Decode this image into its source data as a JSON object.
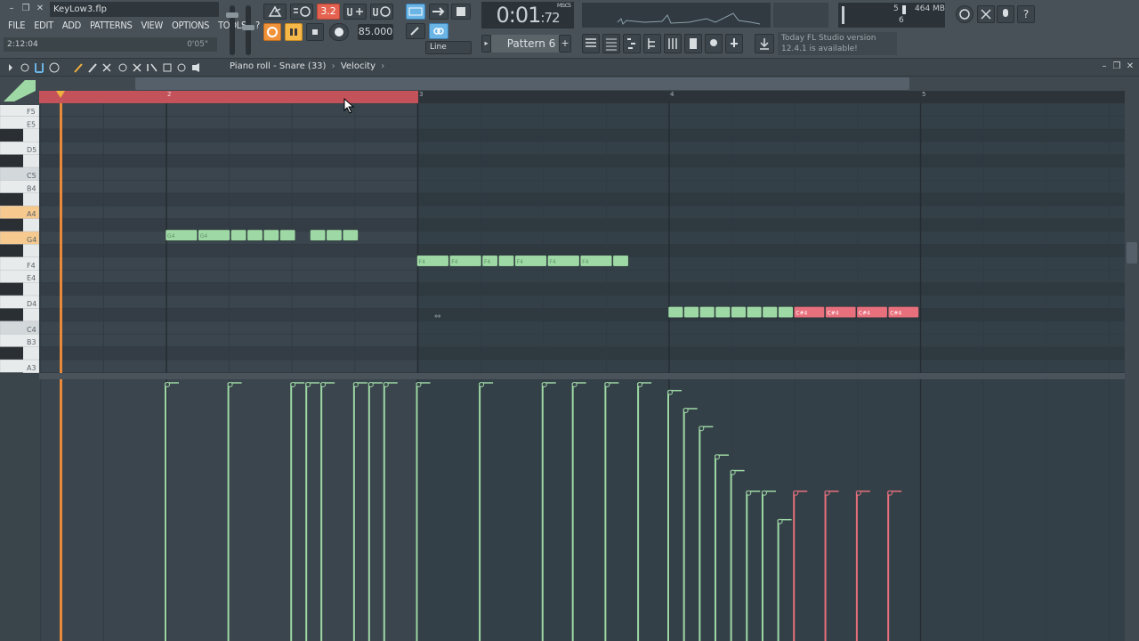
{
  "window": {
    "project_name": "KeyLow3.flp",
    "hint_left": "2:12:04",
    "hint_right": "0'05\""
  },
  "menu": [
    "FILE",
    "EDIT",
    "ADD",
    "PATTERNS",
    "VIEW",
    "OPTIONS",
    "TOOLS",
    "?"
  ],
  "transport": {
    "tempo": "85.000",
    "time_main": "0:01",
    "time_sub": "72",
    "time_unit": "M:S:CS",
    "snap_label": "Line",
    "cpu_value": "5",
    "memory": "464 MB",
    "poly": "6",
    "record_mode_label": "3.2"
  },
  "pattern": {
    "label": "Pattern 6"
  },
  "news": {
    "line1": "Today  FL Studio version",
    "line2": "12.4.1 is available!"
  },
  "pianoroll": {
    "title": "Piano roll - Snare (33)",
    "separator": "›",
    "target": "Velocity",
    "bar_numbers": [
      "2",
      "3",
      "4",
      "5"
    ],
    "key_labels": [
      "F5",
      "E5",
      "D5",
      "C5",
      "B4",
      "A4",
      "G4",
      "F4",
      "E4",
      "D4",
      "C4",
      "B3",
      "A3"
    ],
    "highlight_keys": [
      "A4",
      "G4"
    ],
    "notes": [
      {
        "pitch": "G4",
        "start": 0.0,
        "len": 0.13,
        "label": "G4",
        "color": "green"
      },
      {
        "pitch": "G4",
        "start": 0.13,
        "len": 0.13,
        "label": "G4",
        "color": "green"
      },
      {
        "pitch": "G4",
        "start": 0.26,
        "len": 0.065,
        "label": "",
        "color": "green"
      },
      {
        "pitch": "G4",
        "start": 0.325,
        "len": 0.065,
        "label": "",
        "color": "green"
      },
      {
        "pitch": "G4",
        "start": 0.39,
        "len": 0.065,
        "label": "",
        "color": "green"
      },
      {
        "pitch": "G4",
        "start": 0.455,
        "len": 0.065,
        "label": "",
        "color": "green"
      },
      {
        "pitch": "G4",
        "start": 0.575,
        "len": 0.065,
        "label": "",
        "color": "green"
      },
      {
        "pitch": "G4",
        "start": 0.64,
        "len": 0.065,
        "label": "",
        "color": "green"
      },
      {
        "pitch": "G4",
        "start": 0.705,
        "len": 0.065,
        "label": "",
        "color": "green"
      },
      {
        "pitch": "F4",
        "start": 1.0,
        "len": 0.13,
        "label": "F4",
        "color": "green"
      },
      {
        "pitch": "F4",
        "start": 1.13,
        "len": 0.13,
        "label": "F4",
        "color": "green"
      },
      {
        "pitch": "F4",
        "start": 1.26,
        "len": 0.065,
        "label": "F4",
        "color": "green"
      },
      {
        "pitch": "F4",
        "start": 1.325,
        "len": 0.065,
        "label": "",
        "color": "green"
      },
      {
        "pitch": "F4",
        "start": 1.39,
        "len": 0.13,
        "label": "F4",
        "color": "green"
      },
      {
        "pitch": "F4",
        "start": 1.52,
        "len": 0.13,
        "label": "F4",
        "color": "green"
      },
      {
        "pitch": "F4",
        "start": 1.65,
        "len": 0.13,
        "label": "F4",
        "color": "green"
      },
      {
        "pitch": "F4",
        "start": 1.78,
        "len": 0.065,
        "label": "",
        "color": "green"
      },
      {
        "pitch": "C#4",
        "start": 2.0,
        "len": 0.0625,
        "label": "",
        "color": "green"
      },
      {
        "pitch": "C#4",
        "start": 2.0625,
        "len": 0.0625,
        "label": "",
        "color": "green"
      },
      {
        "pitch": "C#4",
        "start": 2.125,
        "len": 0.0625,
        "label": "",
        "color": "green"
      },
      {
        "pitch": "C#4",
        "start": 2.1875,
        "len": 0.0625,
        "label": "",
        "color": "green"
      },
      {
        "pitch": "C#4",
        "start": 2.25,
        "len": 0.0625,
        "label": "",
        "color": "green"
      },
      {
        "pitch": "C#4",
        "start": 2.3125,
        "len": 0.0625,
        "label": "",
        "color": "green"
      },
      {
        "pitch": "C#4",
        "start": 2.375,
        "len": 0.0625,
        "label": "",
        "color": "green"
      },
      {
        "pitch": "C#4",
        "start": 2.4375,
        "len": 0.0625,
        "label": "",
        "color": "green"
      },
      {
        "pitch": "C#4",
        "start": 2.5,
        "len": 0.125,
        "label": "C#4",
        "color": "red"
      },
      {
        "pitch": "C#4",
        "start": 2.625,
        "len": 0.125,
        "label": "C#4",
        "color": "red"
      },
      {
        "pitch": "C#4",
        "start": 2.75,
        "len": 0.125,
        "label": "C#4",
        "color": "red"
      },
      {
        "pitch": "C#4",
        "start": 2.875,
        "len": 0.125,
        "label": "C#4",
        "color": "red"
      }
    ],
    "velocities": [
      {
        "t": 0.0,
        "v": 1.0,
        "c": "green"
      },
      {
        "t": 0.25,
        "v": 1.0,
        "c": "green"
      },
      {
        "t": 0.5,
        "v": 1.0,
        "c": "green"
      },
      {
        "t": 0.56,
        "v": 1.0,
        "c": "green"
      },
      {
        "t": 0.62,
        "v": 1.0,
        "c": "green"
      },
      {
        "t": 0.75,
        "v": 1.0,
        "c": "green"
      },
      {
        "t": 0.81,
        "v": 1.0,
        "c": "green"
      },
      {
        "t": 0.87,
        "v": 1.0,
        "c": "green"
      },
      {
        "t": 1.0,
        "v": 1.0,
        "c": "green"
      },
      {
        "t": 1.25,
        "v": 1.0,
        "c": "green"
      },
      {
        "t": 1.5,
        "v": 1.0,
        "c": "green"
      },
      {
        "t": 1.62,
        "v": 1.0,
        "c": "green"
      },
      {
        "t": 1.75,
        "v": 1.0,
        "c": "green"
      },
      {
        "t": 1.88,
        "v": 1.0,
        "c": "green"
      },
      {
        "t": 2.0,
        "v": 0.97,
        "c": "green"
      },
      {
        "t": 2.0625,
        "v": 0.9,
        "c": "green"
      },
      {
        "t": 2.125,
        "v": 0.83,
        "c": "green"
      },
      {
        "t": 2.1875,
        "v": 0.72,
        "c": "green"
      },
      {
        "t": 2.25,
        "v": 0.66,
        "c": "green"
      },
      {
        "t": 2.3125,
        "v": 0.58,
        "c": "green"
      },
      {
        "t": 2.375,
        "v": 0.58,
        "c": "green"
      },
      {
        "t": 2.4375,
        "v": 0.47,
        "c": "green"
      },
      {
        "t": 2.5,
        "v": 0.58,
        "c": "red"
      },
      {
        "t": 2.625,
        "v": 0.58,
        "c": "red"
      },
      {
        "t": 2.75,
        "v": 0.58,
        "c": "red"
      },
      {
        "t": 2.875,
        "v": 0.58,
        "c": "red"
      }
    ]
  },
  "colors": {
    "note_green": "#9ed9a5",
    "note_red": "#e8707d",
    "loop_region": "#c4525b",
    "playhead": "#e98a3a",
    "grid_bg": "#3a454d",
    "grid_inactive": "#344048"
  }
}
